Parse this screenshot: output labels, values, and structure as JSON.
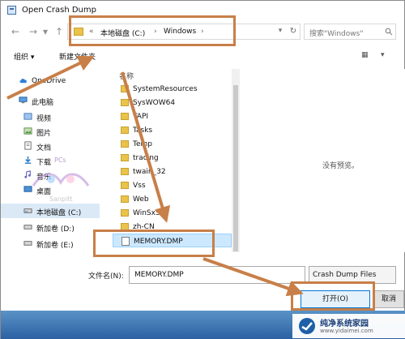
{
  "window": {
    "title": "Open Crash Dump"
  },
  "nav": {
    "back": "←",
    "forward": "→",
    "dropdown": "▾",
    "up": "↑",
    "breadcrumb_prefix": "«",
    "path": [
      "本地磁盘 (C:)",
      "Windows"
    ],
    "separator": "›",
    "refresh": "↻",
    "search_placeholder": "搜索\"Windows\""
  },
  "toolbar": {
    "organize": "组织",
    "organize_caret": "▾",
    "new_folder": "新建文件夹",
    "view_icon": "▦",
    "view_caret": "▾"
  },
  "sidebar": [
    {
      "label": "OneDrive",
      "icon": "cloud-icon",
      "active": false
    },
    {
      "label": "此电脑",
      "icon": "computer-icon",
      "active": false
    },
    {
      "label": "视频",
      "icon": "video-icon",
      "active": false
    },
    {
      "label": "图片",
      "icon": "picture-icon",
      "active": false
    },
    {
      "label": "文档",
      "icon": "document-icon",
      "active": false
    },
    {
      "label": "下载",
      "icon": "download-icon",
      "active": false
    },
    {
      "label": "音乐",
      "icon": "music-icon",
      "active": false
    },
    {
      "label": "桌面",
      "icon": "desktop-icon",
      "active": false
    },
    {
      "label": "本地磁盘 (C:)",
      "icon": "drive-icon",
      "active": true
    },
    {
      "label": "新加卷 (D:)",
      "icon": "drive-icon",
      "active": false
    },
    {
      "label": "新加卷 (E:)",
      "icon": "drive-icon",
      "active": false
    }
  ],
  "list": {
    "header": "名称",
    "items": [
      {
        "label": "SystemResources",
        "type": "folder",
        "selected": false
      },
      {
        "label": "SysWOW64",
        "type": "folder",
        "selected": false
      },
      {
        "label": "TAPI",
        "type": "folder",
        "selected": false
      },
      {
        "label": "Tasks",
        "type": "folder",
        "selected": false
      },
      {
        "label": "Temp",
        "type": "folder",
        "selected": false
      },
      {
        "label": "tracing",
        "type": "folder",
        "selected": false
      },
      {
        "label": "twain_32",
        "type": "folder",
        "selected": false
      },
      {
        "label": "Vss",
        "type": "folder",
        "selected": false
      },
      {
        "label": "Web",
        "type": "folder",
        "selected": false
      },
      {
        "label": "WinSxS",
        "type": "folder",
        "selected": false
      },
      {
        "label": "zh-CN",
        "type": "folder",
        "selected": false
      },
      {
        "label": "MEMORY.DMP",
        "type": "file",
        "selected": true
      }
    ]
  },
  "preview": {
    "empty_text": "没有预览。"
  },
  "footer": {
    "filename_label": "文件名(N):",
    "filename_value": "MEMORY.DMP",
    "filter_value": "Crash Dump Files",
    "open_label": "打开(O)",
    "cancel_label": "取消"
  },
  "watermark": {
    "top": "PCs",
    "bottom": "Sanpitt"
  },
  "logo": {
    "title": "纯净系统家园",
    "url": "www.yidaimei.com"
  },
  "colors": {
    "accent": "#c87f48",
    "selection": "#cce8ff",
    "taskbar": "#2b5fa1"
  }
}
